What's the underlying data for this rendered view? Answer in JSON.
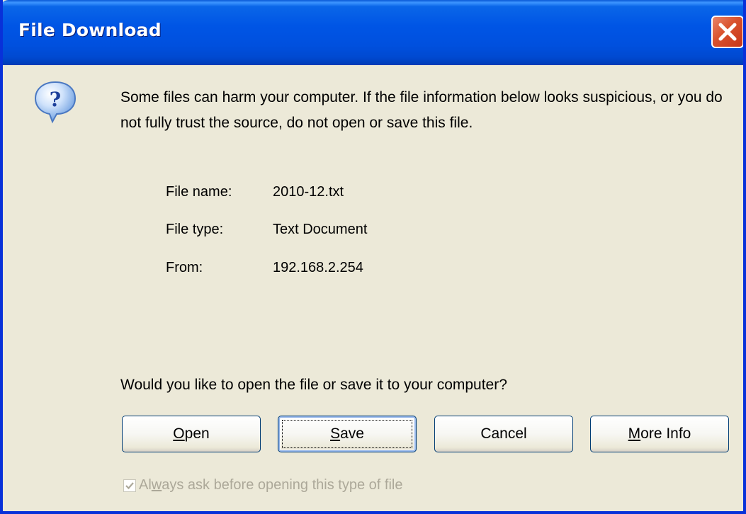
{
  "window": {
    "title": "File Download"
  },
  "message": "Some files can harm your computer. If the file information below looks suspicious, or you do not fully trust the source, do not open or save this file.",
  "file_info": {
    "name_label": "File name:",
    "name_value": "2010-12.txt",
    "type_label": "File type:",
    "type_value": "Text Document",
    "from_label": "From:",
    "from_value": "192.168.2.254"
  },
  "prompt": "Would you like to open the file or save it to your computer?",
  "buttons": {
    "open": {
      "access_key": "O",
      "rest": "pen"
    },
    "save": {
      "access_key": "S",
      "rest": "ave"
    },
    "cancel": {
      "label": "Cancel"
    },
    "more_info": {
      "access_key": "M",
      "rest": "ore Info"
    }
  },
  "checkbox": {
    "label_before": "Al",
    "access_key": "w",
    "label_after": "ays ask before opening this type of file",
    "checked": true,
    "disabled": true
  },
  "icons": {
    "dialog": "question-icon",
    "close": "close-icon",
    "check": "checkmark-icon"
  },
  "colors": {
    "titlebar": "#0055e5",
    "close_button": "#d9512c",
    "dialog_background": "#ece9d8",
    "disabled_text": "#aca899"
  }
}
